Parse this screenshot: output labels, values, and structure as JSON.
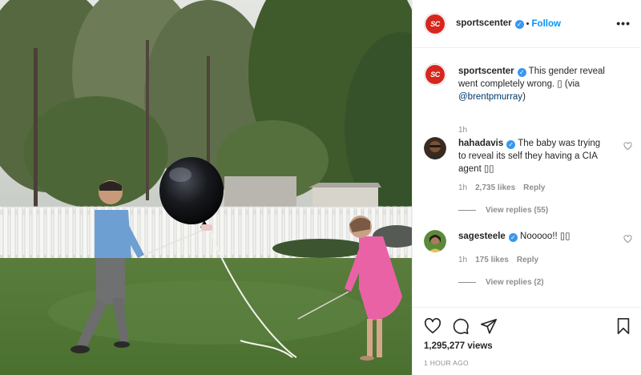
{
  "post": {
    "username": "sportscenter",
    "verified_mark": "✓",
    "dot": "•",
    "follow_label": "Follow",
    "more_label": "•••",
    "avatar_text": "SC",
    "brand_color": "#d7261e"
  },
  "caption": {
    "username": "sportscenter",
    "text_before": "This gender reveal went completely wrong. ",
    "emoji": "▯",
    "text_via": " (via ",
    "mention": "@brentpmurray",
    "text_after": ")",
    "time": "1h"
  },
  "comments": [
    {
      "username": "hahadavis",
      "text": "The baby was trying to reveal its self they having a CIA agent ▯▯",
      "time": "1h",
      "likes": "2,735 likes",
      "reply_label": "Reply",
      "view_replies": "View replies (55)"
    },
    {
      "username": "sagesteele",
      "text": "Nooooo!! ▯▯",
      "time": "1h",
      "likes": "175 likes",
      "reply_label": "Reply",
      "view_replies": "View replies (2)"
    }
  ],
  "actions": {
    "icons": [
      "heart-icon",
      "comment-icon",
      "share-icon",
      "bookmark-icon"
    ],
    "views": "1,295,277 views",
    "posted": "1 HOUR AGO"
  }
}
